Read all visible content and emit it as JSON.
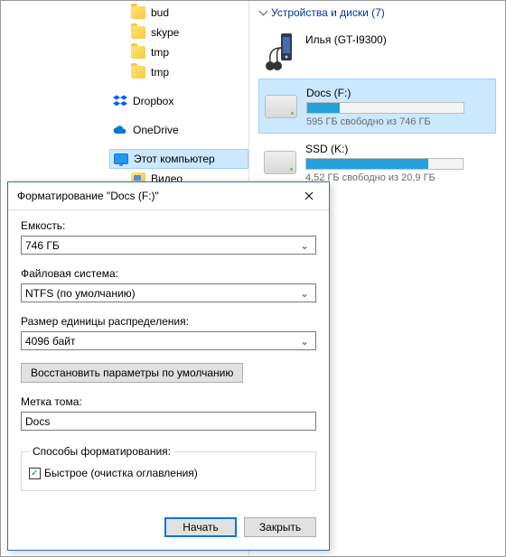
{
  "nav": {
    "items": [
      {
        "label": "bud"
      },
      {
        "label": "skype"
      },
      {
        "label": "tmp"
      },
      {
        "label": "tmp"
      },
      {
        "label": "Dropbox"
      },
      {
        "label": "OneDrive"
      },
      {
        "label": "Этот компьютер"
      },
      {
        "label": "Видео"
      }
    ]
  },
  "content": {
    "section_title": "Устройства и диски (7)",
    "devices": [
      {
        "name": "Илья (GT-I9300)"
      },
      {
        "name": "Docs (F:)",
        "sub": "595 ГБ свободно из 746 ГБ",
        "fill_pct": 21
      },
      {
        "name": "SSD (K:)",
        "sub": "4,52 ГБ свободно из 20,9 ГБ",
        "fill_pct": 78
      }
    ]
  },
  "dialog": {
    "title": "Форматирование \"Docs (F:)\"",
    "labels": {
      "capacity": "Емкость:",
      "filesystem": "Файловая система:",
      "alloc": "Размер единицы распределения:",
      "restore": "Восстановить параметры по умолчанию",
      "volume_label": "Метка тома:",
      "methods": "Способы форматирования:",
      "quick": "Быстрое (очистка оглавления)",
      "start": "Начать",
      "close": "Закрыть"
    },
    "values": {
      "capacity": "746 ГБ",
      "filesystem": "NTFS (по умолчанию)",
      "alloc": "4096 байт",
      "volume_label": "Docs",
      "quick_checked": true
    }
  }
}
